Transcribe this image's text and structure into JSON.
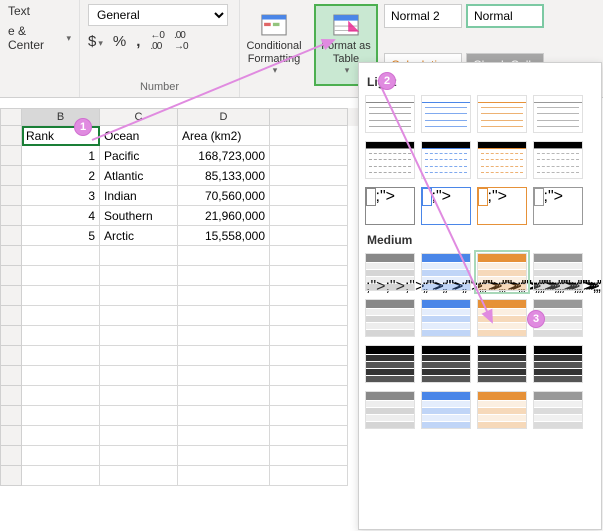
{
  "ribbon": {
    "alignment": {
      "wrap_text": "Text",
      "merge_center": "e & Center",
      "group_label": ""
    },
    "number": {
      "format": "General",
      "group_label": "Number"
    },
    "styles": {
      "conditional": "Conditional Formatting",
      "format_table": "Format as Table",
      "normal2": "Normal 2",
      "normal": "Normal",
      "calculation": "Calculation",
      "check_cell": "Check Cell"
    }
  },
  "badges": {
    "b1": "1",
    "b2": "2",
    "b3": "3"
  },
  "gallery": {
    "section_light": "Light",
    "section_medium": "Medium"
  },
  "sheet": {
    "columns": {
      "B": "B",
      "C": "C",
      "D": "D",
      "E": ""
    },
    "headers": {
      "rank": "Rank",
      "ocean": "Ocean",
      "area": "Area (km2)"
    },
    "rows": [
      {
        "rank": "1",
        "ocean": "Pacific",
        "area": "168,723,000"
      },
      {
        "rank": "2",
        "ocean": "Atlantic",
        "area": "85,133,000"
      },
      {
        "rank": "3",
        "ocean": "Indian",
        "area": "70,560,000"
      },
      {
        "rank": "4",
        "ocean": "Southern",
        "area": "21,960,000"
      },
      {
        "rank": "5",
        "ocean": "Arctic",
        "area": "15,558,000"
      }
    ]
  }
}
